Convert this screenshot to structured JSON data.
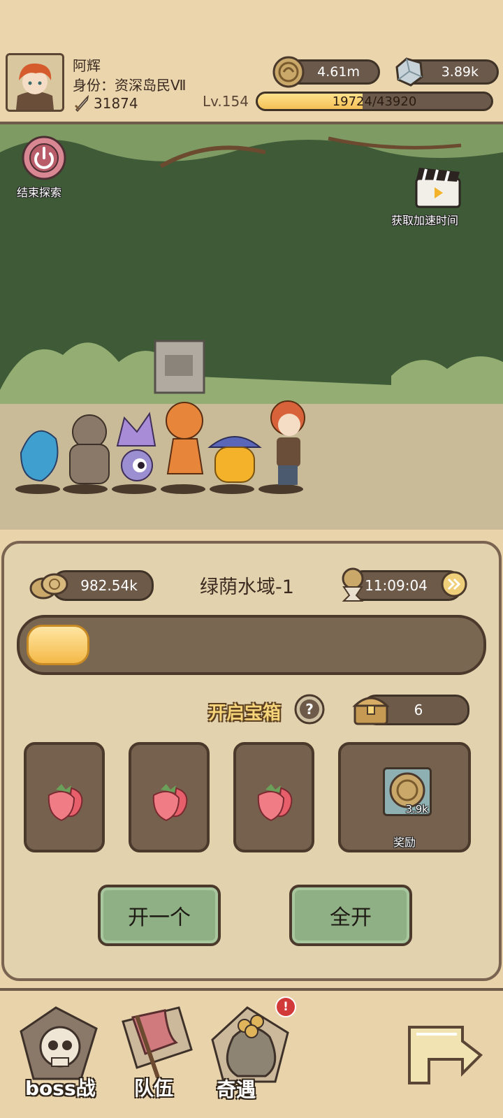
{
  "player": {
    "name": "阿辉",
    "identity": "身份：资深岛民Ⅶ",
    "power": "31874",
    "level": "Lv.154",
    "xp_text": "19724/43920",
    "xp_progress": 0.449
  },
  "currency": {
    "coins": "4.61m",
    "diamonds": "3.89k"
  },
  "scene": {
    "end_explore_label": "结束探索",
    "speedup_label": "获取加速时间"
  },
  "explore": {
    "zone_title": "绿荫水域-1",
    "gold_amount": "982.54k",
    "timer": "11:09:04",
    "progress": 0.14
  },
  "chest": {
    "title": "开启宝箱",
    "count": "6",
    "slots": [
      {
        "item": "strawberry-icon"
      },
      {
        "item": "strawberry-icon"
      },
      {
        "item": "strawberry-icon"
      }
    ],
    "reward_label": "奖励",
    "reward_amount": "3.9k",
    "open_one_label": "开一个",
    "open_all_label": "全开"
  },
  "nav": {
    "boss_label": "boss战",
    "team_label": "队伍",
    "encounter_label": "奇遇",
    "badge": "!"
  },
  "colors": {
    "accent_gold": "#f3c057",
    "button_green": "#8faf85",
    "panel_bg": "#e3d2ae"
  }
}
